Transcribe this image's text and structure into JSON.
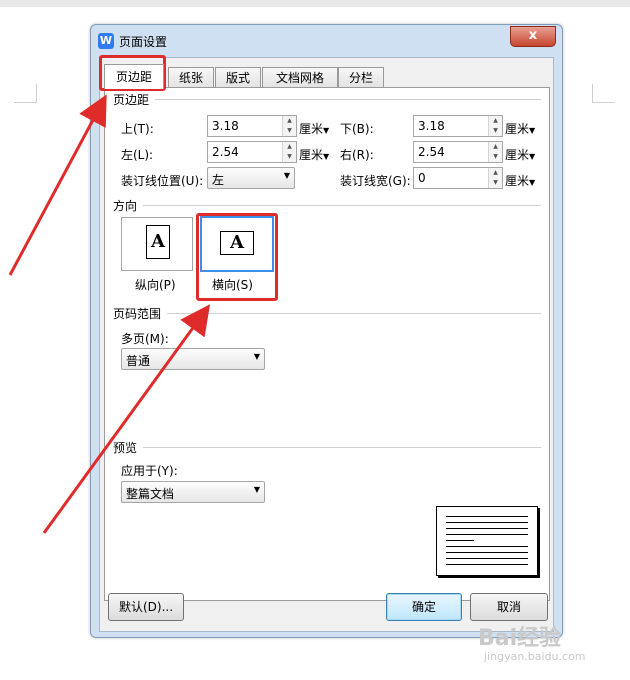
{
  "dialog": {
    "title": "页面设置",
    "logo_letter": "W",
    "close_glyph": "x",
    "tabs": [
      {
        "label": "页边距"
      },
      {
        "label": "纸张"
      },
      {
        "label": "版式"
      },
      {
        "label": "文档网格"
      },
      {
        "label": "分栏"
      }
    ],
    "margins": {
      "section_title": "页边距",
      "top_label": "上(T):",
      "top_value": "3.18",
      "bottom_label": "下(B):",
      "bottom_value": "3.18",
      "left_label": "左(L):",
      "left_value": "2.54",
      "right_label": "右(R):",
      "right_value": "2.54",
      "gutter_pos_label": "装订线位置(U):",
      "gutter_pos_value": "左",
      "gutter_width_label": "装订线宽(G):",
      "gutter_width_value": "0",
      "unit": "厘米"
    },
    "orientation": {
      "section_title": "方向",
      "portrait_label": "纵向(P)",
      "landscape_label": "横向(S)",
      "icon_letter": "A"
    },
    "pages": {
      "section_title": "页码范围",
      "multi_label": "多页(M):",
      "multi_value": "普通"
    },
    "preview": {
      "section_title": "预览",
      "apply_label": "应用于(Y):",
      "apply_value": "整篇文档"
    },
    "buttons": {
      "default_label": "默认(D)...",
      "ok_label": "确定",
      "cancel_label": "取消"
    }
  },
  "watermark": {
    "brand": "Bai经验",
    "url": "jingyan.baidu.com"
  },
  "colors": {
    "highlight": "#e02b2b",
    "title_accent": "#2f7ef1"
  }
}
